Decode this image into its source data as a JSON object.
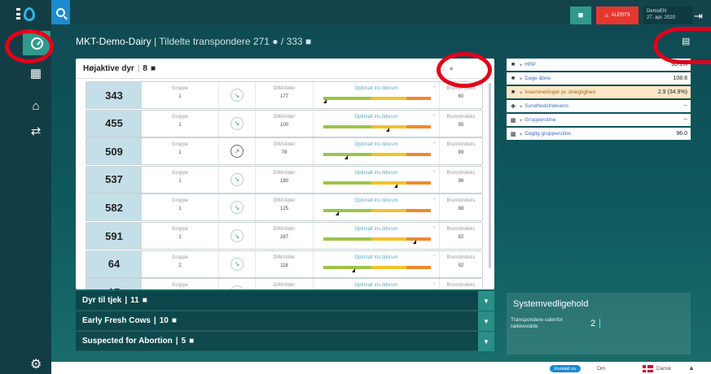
{
  "header": {
    "cow_icon": "cow-icon",
    "alerts_label": "ALERTS",
    "user_name": "DemoEN",
    "date": "27. apr. 2020"
  },
  "sidebar": {
    "items": [
      {
        "icon": "dashboard-icon"
      },
      {
        "icon": "building-icon"
      },
      {
        "icon": "barn-icon"
      },
      {
        "icon": "hand-cow-icon"
      }
    ],
    "settings_icon": "gear-icon"
  },
  "title": {
    "farm": "MKT-Demo-Dairy",
    "separator": "|",
    "label": "Tildelte transpondere",
    "count1": "271",
    "slash": "/",
    "count2": "333"
  },
  "card": {
    "title": "Højaktive dyr",
    "sep": "|",
    "count": "8",
    "col_group": "Gruppe",
    "col_dim": "DIM/Alder",
    "col_opt": "Optimalt ins.tidsrum",
    "col_heat": "Brunstindeks",
    "rows": [
      {
        "num": "343",
        "group": "1",
        "dim": "177",
        "heat": "60",
        "icon": "gauge-icon",
        "marker": 0.0
      },
      {
        "num": "455",
        "group": "1",
        "dim": "100",
        "heat": "95",
        "icon": "gauge-icon",
        "marker": 0.6
      },
      {
        "num": "509",
        "group": "1",
        "dim": "78",
        "heat": "89",
        "icon": "rocket-icon",
        "marker": 0.2
      },
      {
        "num": "537",
        "group": "1",
        "dim": "180",
        "heat": "96",
        "icon": "gauge-icon",
        "marker": 0.68
      },
      {
        "num": "582",
        "group": "1",
        "dim": "125",
        "heat": "88",
        "icon": "gauge-icon",
        "marker": 0.12
      },
      {
        "num": "591",
        "group": "1",
        "dim": "287",
        "heat": "82",
        "icon": "gauge-icon",
        "marker": 0.86
      },
      {
        "num": "64",
        "group": "2",
        "dim": "118",
        "heat": "92",
        "icon": "gauge-icon",
        "marker": 0.27
      },
      {
        "num": "17",
        "group": "",
        "dim": "",
        "heat": "",
        "icon": "gauge-icon",
        "marker": null
      }
    ]
  },
  "accordions": [
    {
      "title": "Dyr til tjek",
      "sep": "|",
      "count": "11"
    },
    {
      "title": "Early Fresh Cows",
      "sep": "|",
      "count": "10"
    },
    {
      "title": "Suspected for Abortion",
      "sep": "|",
      "count": "5"
    }
  ],
  "metrics": [
    {
      "icon": "cow-icon",
      "label": "HRP",
      "value": "90.9%"
    },
    {
      "icon": "cow-icon",
      "label": "Dage åbne",
      "value": "108.8"
    },
    {
      "icon": "cow-icon",
      "label": "Insemineringer pr. drægtighed",
      "value": "2.9 (34.9%)"
    },
    {
      "icon": "health-icon",
      "label": "Sundhedsfrekvens",
      "value": "--"
    },
    {
      "icon": "calendar-icon",
      "label": "Grupperutine",
      "value": "--"
    },
    {
      "icon": "calendar-icon",
      "label": "Daglig grupperutine",
      "value": "96.0"
    }
  ],
  "system": {
    "title": "Systemvedligehold",
    "label": "Transpondere udenfor rækkevidde",
    "value": "2"
  },
  "footer": {
    "contact": "Kontakt os",
    "about": "Om",
    "language": "Dansk"
  },
  "colors": {
    "sidebar": "#133d45",
    "main": "#0f4a52",
    "accent": "#2f9a8c",
    "alert": "#e5372f",
    "blue": "#1b8bcf",
    "annotation": "#e3001b"
  }
}
